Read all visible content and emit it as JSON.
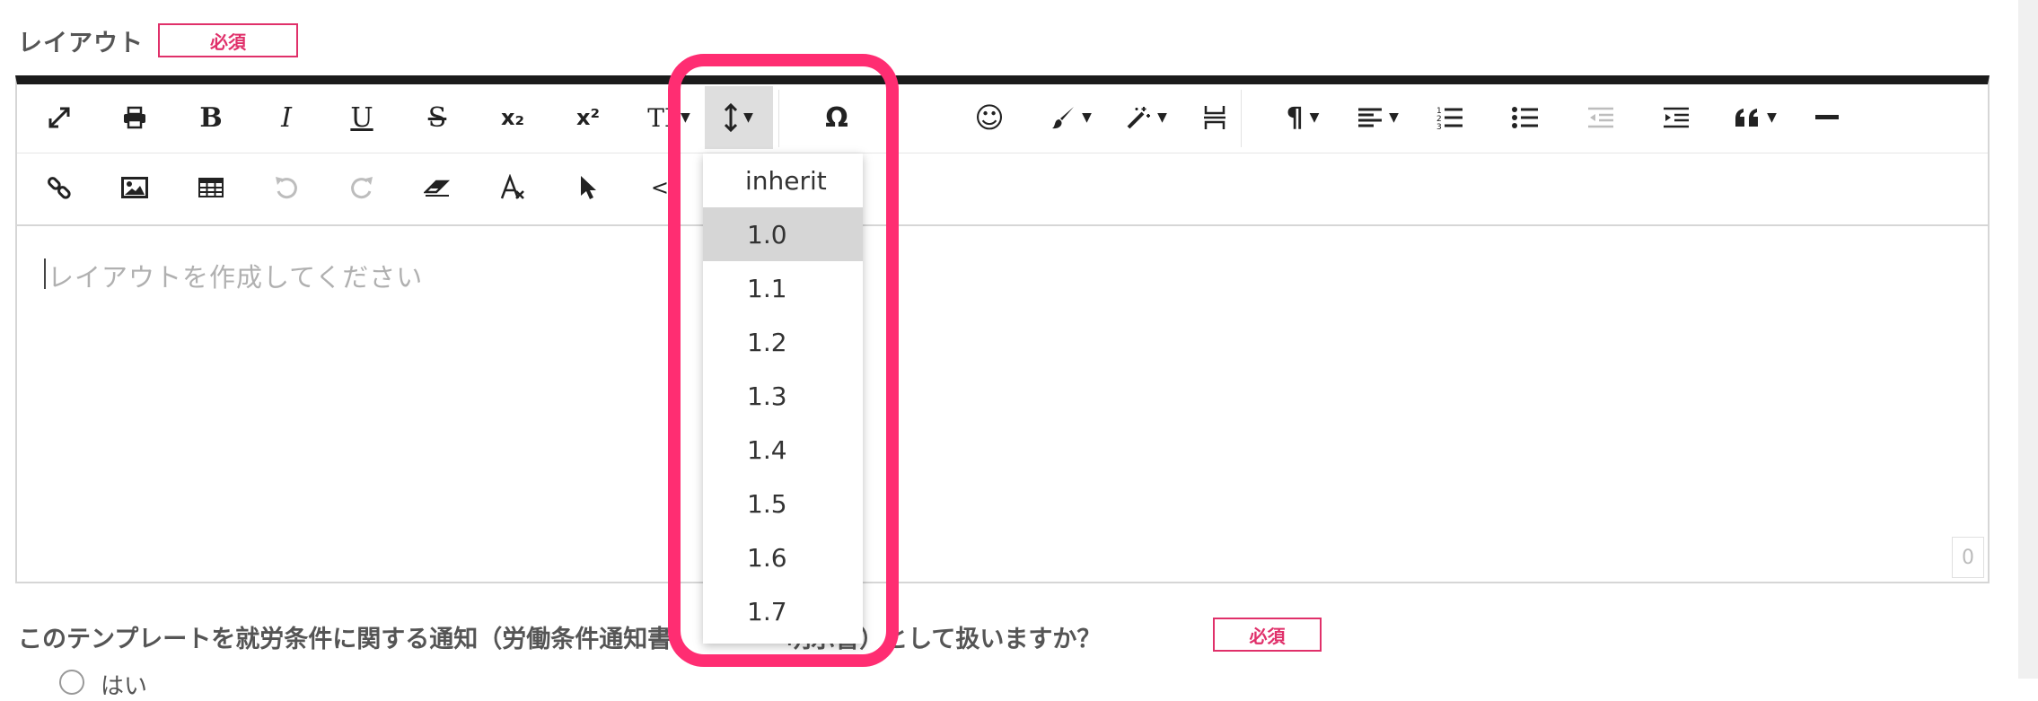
{
  "layout_field": {
    "label": "レイアウト",
    "required_label": "必須"
  },
  "toolbar": {
    "row1": [
      {
        "name": "fullscreen",
        "icon": "expand-icon"
      },
      {
        "name": "print",
        "icon": "print-icon"
      },
      {
        "name": "bold",
        "icon": "bold-icon",
        "label": "B"
      },
      {
        "name": "italic",
        "icon": "italic-icon",
        "label": "I"
      },
      {
        "name": "underline",
        "icon": "underline-icon",
        "label": "U"
      },
      {
        "name": "strikethrough",
        "icon": "strikethrough-icon",
        "label": "S"
      },
      {
        "name": "subscript",
        "icon": "subscript-icon",
        "label": "x₂"
      },
      {
        "name": "superscript",
        "icon": "superscript-icon",
        "label": "x²"
      },
      {
        "name": "font-size",
        "icon": "text-height-icon",
        "label": "TI"
      },
      {
        "name": "line-height",
        "icon": "line-height-icon",
        "active": true
      },
      {
        "name": "special-chars",
        "icon": "omega-icon",
        "label": "Ω"
      },
      {
        "name": "emoji",
        "icon": "smile-icon",
        "label": "☺"
      },
      {
        "name": "text-color",
        "icon": "paint-brush-icon"
      },
      {
        "name": "styles",
        "icon": "magic-wand-icon"
      },
      {
        "name": "page-break",
        "icon": "page-break-icon"
      },
      {
        "name": "paragraph-format",
        "icon": "paragraph-icon",
        "label": "¶"
      },
      {
        "name": "align",
        "icon": "align-left-icon"
      },
      {
        "name": "ordered-list",
        "icon": "ordered-list-icon"
      },
      {
        "name": "unordered-list",
        "icon": "unordered-list-icon"
      },
      {
        "name": "outdent",
        "icon": "outdent-icon",
        "disabled": true
      },
      {
        "name": "indent",
        "icon": "indent-icon"
      },
      {
        "name": "quote",
        "icon": "quote-icon"
      },
      {
        "name": "horizontal-line",
        "icon": "horizontal-line-icon"
      }
    ],
    "row2": [
      {
        "name": "link",
        "icon": "link-icon"
      },
      {
        "name": "image",
        "icon": "image-icon"
      },
      {
        "name": "table",
        "icon": "table-icon"
      },
      {
        "name": "undo",
        "icon": "undo-icon",
        "disabled": true
      },
      {
        "name": "redo",
        "icon": "redo-icon",
        "disabled": true
      },
      {
        "name": "clear",
        "icon": "eraser-icon"
      },
      {
        "name": "clear-formatting",
        "icon": "clear-format-icon"
      },
      {
        "name": "select-all",
        "icon": "pointer-icon"
      },
      {
        "name": "code-view",
        "icon": "code-icon",
        "label": "</"
      }
    ]
  },
  "editor": {
    "placeholder": "レイアウトを作成してください",
    "char_count": "0"
  },
  "line_height_dropdown": {
    "options": [
      "inherit",
      "1.0",
      "1.1",
      "1.2",
      "1.3",
      "1.4",
      "1.5",
      "1.6",
      "1.7"
    ],
    "selected": "1.0"
  },
  "question": {
    "text": "このテンプレートを就労条件に関する通知（労働条件通知書",
    "text_tail": "明示書）として扱いますか？",
    "required_label": "必須",
    "option_yes": "はい"
  },
  "colors": {
    "accent": "#ff2d72",
    "required": "#e0306a",
    "toolbar_border": "#1b1b1b"
  }
}
